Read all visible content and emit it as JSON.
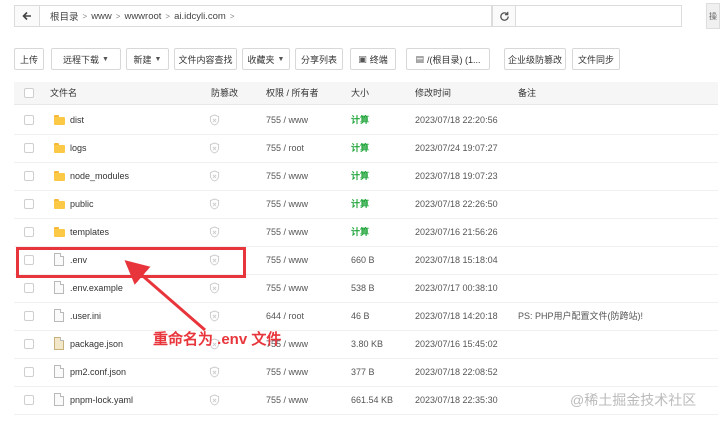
{
  "breadcrumbs": [
    "根目录",
    "www",
    "wwwroot",
    "ai.idcyli.com"
  ],
  "side_button": "操",
  "toolbar": {
    "upload": "上传",
    "remote_download": "远程下载",
    "new": "新建",
    "content_search": "文件内容查找",
    "favorites": "收藏夹",
    "share_list": "分享列表",
    "terminal": "终端",
    "root_dir": "/(根目录) (1...",
    "enterprise_guard": "企业级防篡改",
    "file_sync": "文件同步"
  },
  "table": {
    "headers": {
      "name": "文件名",
      "tamper": "防篡改",
      "perms": "权限 / 所有者",
      "size": "大小",
      "mtime": "修改时间",
      "remark": "备注"
    },
    "rows": [
      {
        "type": "folder",
        "name": "dist",
        "perms": "755 / www",
        "size": "计算",
        "mtime": "2023/07/18 22:20:56",
        "remark": ""
      },
      {
        "type": "folder",
        "name": "logs",
        "perms": "755 / root",
        "size": "计算",
        "mtime": "2023/07/24 19:07:27",
        "remark": ""
      },
      {
        "type": "folder",
        "name": "node_modules",
        "perms": "755 / www",
        "size": "计算",
        "mtime": "2023/07/18 19:07:23",
        "remark": ""
      },
      {
        "type": "folder",
        "name": "public",
        "perms": "755 / www",
        "size": "计算",
        "mtime": "2023/07/18 22:26:50",
        "remark": ""
      },
      {
        "type": "folder",
        "name": "templates",
        "perms": "755 / www",
        "size": "计算",
        "mtime": "2023/07/16 21:56:26",
        "remark": ""
      },
      {
        "type": "file",
        "name": ".env",
        "perms": "755 / www",
        "size": "660 B",
        "mtime": "2023/07/18 15:18:04",
        "remark": ""
      },
      {
        "type": "file",
        "name": ".env.example",
        "perms": "755 / www",
        "size": "538 B",
        "mtime": "2023/07/17 00:38:10",
        "remark": ""
      },
      {
        "type": "file",
        "name": ".user.ini",
        "perms": "644 / root",
        "size": "46 B",
        "mtime": "2023/07/18 14:20:18",
        "remark": "PS: PHP用户配置文件(防跨站)!"
      },
      {
        "type": "pkg",
        "name": "package.json",
        "perms": "755 / www",
        "size": "3.80 KB",
        "mtime": "2023/07/16 15:45:02",
        "remark": ""
      },
      {
        "type": "file",
        "name": "pm2.conf.json",
        "perms": "755 / www",
        "size": "377 B",
        "mtime": "2023/07/18 22:08:52",
        "remark": ""
      },
      {
        "type": "file",
        "name": "pnpm-lock.yaml",
        "perms": "755 / www",
        "size": "661.54 KB",
        "mtime": "2023/07/18 22:35:30",
        "remark": ""
      }
    ]
  },
  "annotation": {
    "text": "重命名为 .env 文件"
  },
  "watermark": "@稀土掘金技术社区",
  "colors": {
    "accent_green": "#20a53a",
    "annotation_red": "#e8353b",
    "folder_yellow": "#fcc947"
  }
}
